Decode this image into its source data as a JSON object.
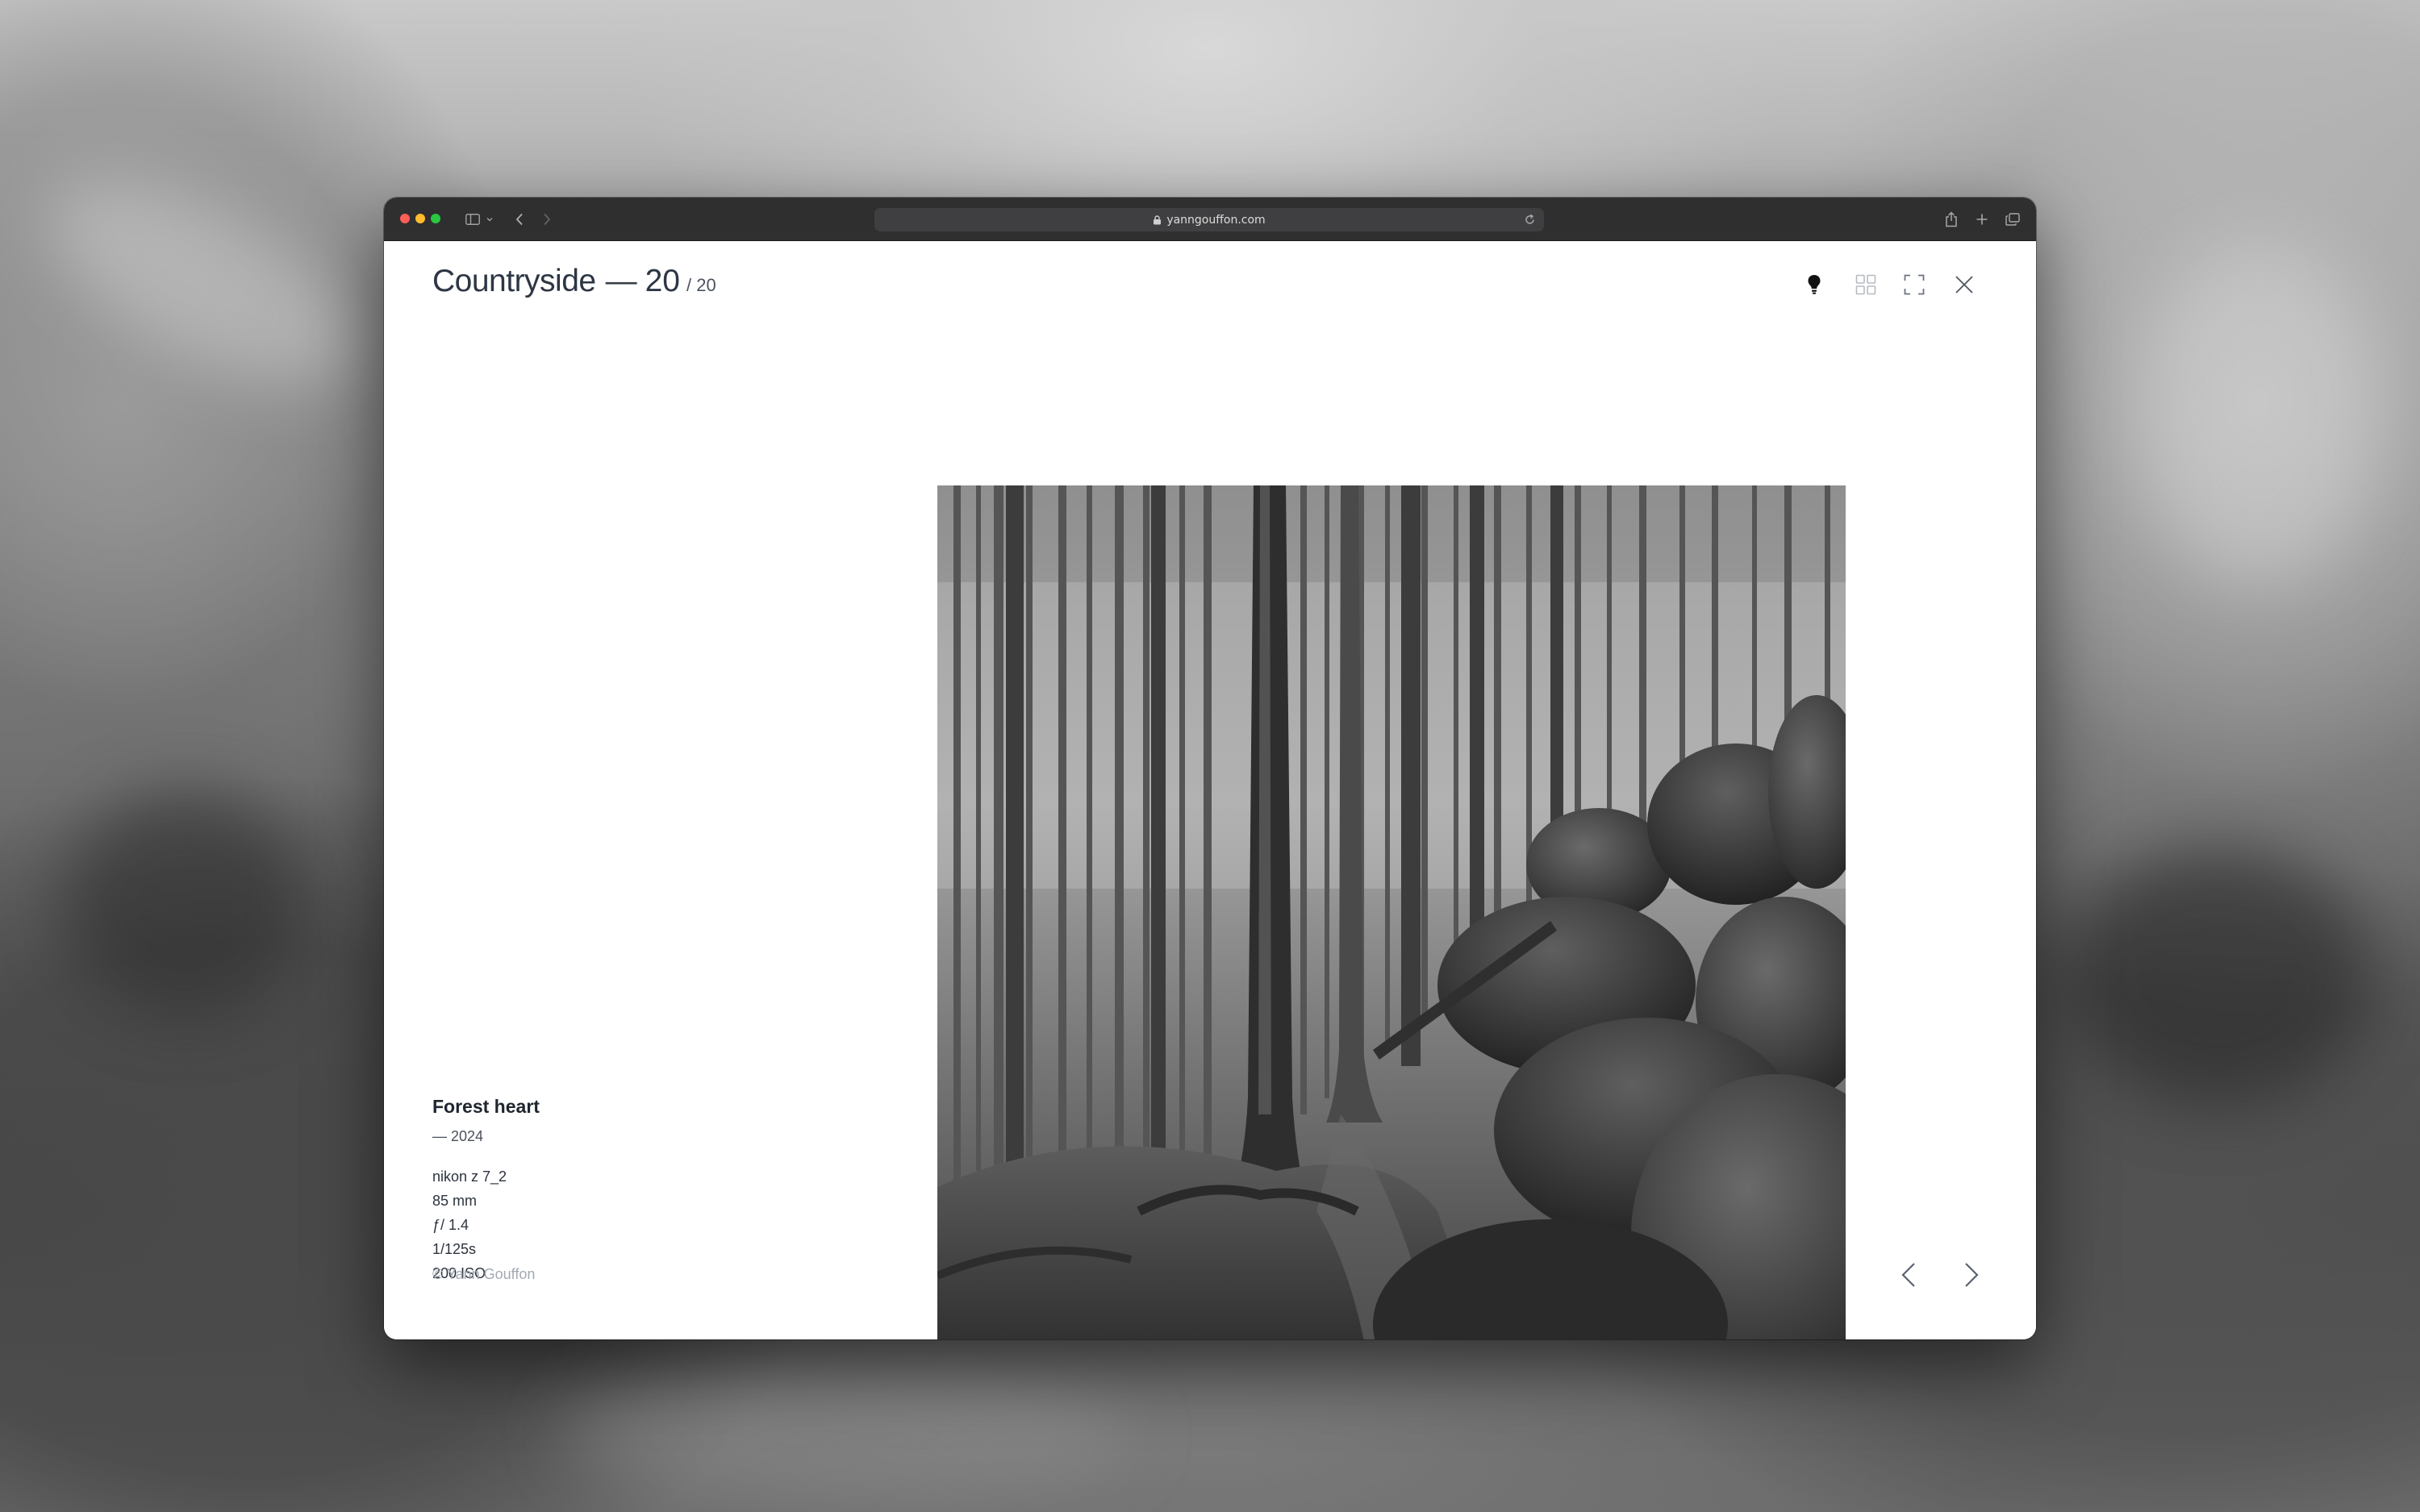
{
  "browser": {
    "url": "yanngouffon.com"
  },
  "gallery": {
    "title": "Countryside",
    "dash": "—",
    "current": "20",
    "total": "/ 20"
  },
  "toolbar": {
    "icons": [
      "lightbulb-icon",
      "grid-icon",
      "fullscreen-icon",
      "close-icon"
    ]
  },
  "photo": {
    "title": "Forest heart",
    "year": "— 2024",
    "exif": {
      "camera": "nikon z 7_2",
      "focal_length": "85 mm",
      "aperture": "ƒ/ 1.4",
      "shutter": "1/125s",
      "iso": "200 ISO"
    }
  },
  "footer": {
    "copyright": "© Yann Gouffon"
  },
  "colors": {
    "text_dark": "#2d3644",
    "text_muted": "#a3a9b2",
    "chrome_bg": "#2f2f30"
  }
}
